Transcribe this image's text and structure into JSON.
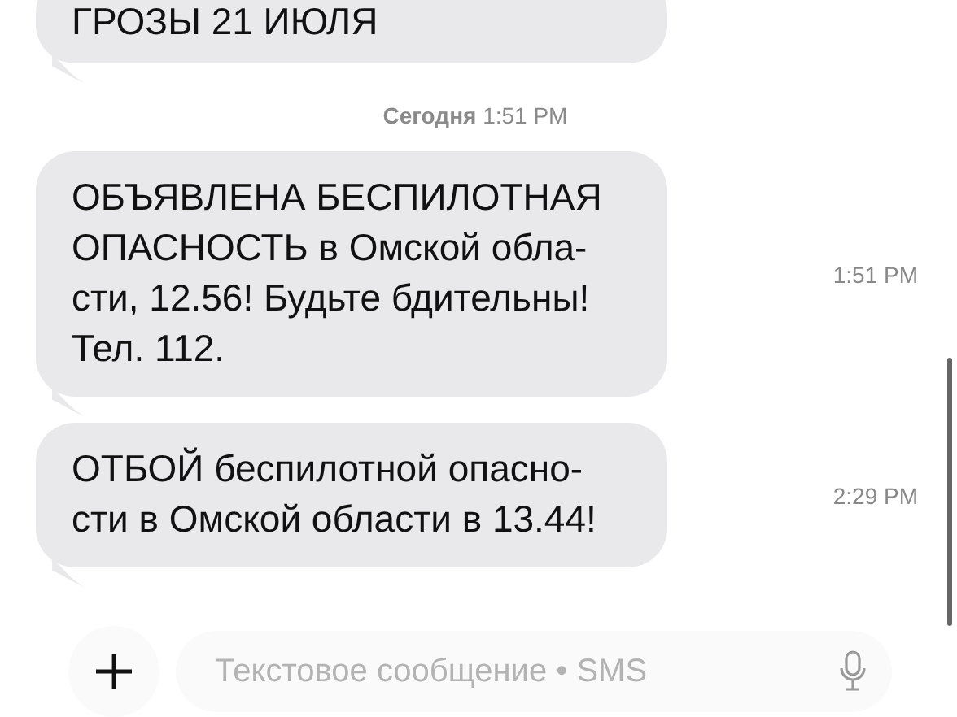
{
  "messages": [
    {
      "kind": "message",
      "text": "ГРОЗЫ 21 ИЮЛЯ"
    },
    {
      "kind": "divider",
      "label": "Сегодня",
      "time": "1:51 PM"
    },
    {
      "kind": "message",
      "text": "ОБЪЯВЛЕНА БЕСПИЛОТНАЯ\nОПАСНОСТЬ в Омской обла-\nсти, 12.56! Будьте бдительны!\nТел. 112.",
      "time": "1:51 PM"
    },
    {
      "kind": "message",
      "text": "ОТБОЙ беспилотной опасно-\nсти в Омской области в 13.44!",
      "time": "2:29 PM"
    }
  ],
  "composer": {
    "placeholder": "Текстовое сообщение • SMS"
  }
}
